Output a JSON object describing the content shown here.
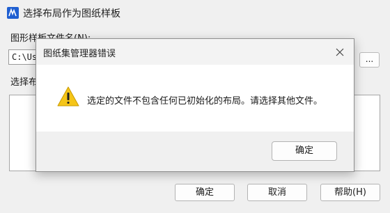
{
  "background_window": {
    "title": "选择布局作为图纸样板",
    "file_label": "图形样板文件名(N):",
    "path_value": "C:\\Us",
    "browse_label": "...",
    "layout_label": "选择布",
    "buttons": {
      "ok": "确定",
      "cancel": "取消",
      "help": "帮助(H)"
    }
  },
  "error_dialog": {
    "title": "图纸集管理器错误",
    "message": "选定的文件不包含任何已初始化的布局。请选择其他文件。",
    "ok_label": "确定",
    "icon": "warning-icon",
    "warning_color": "#f5c518"
  }
}
